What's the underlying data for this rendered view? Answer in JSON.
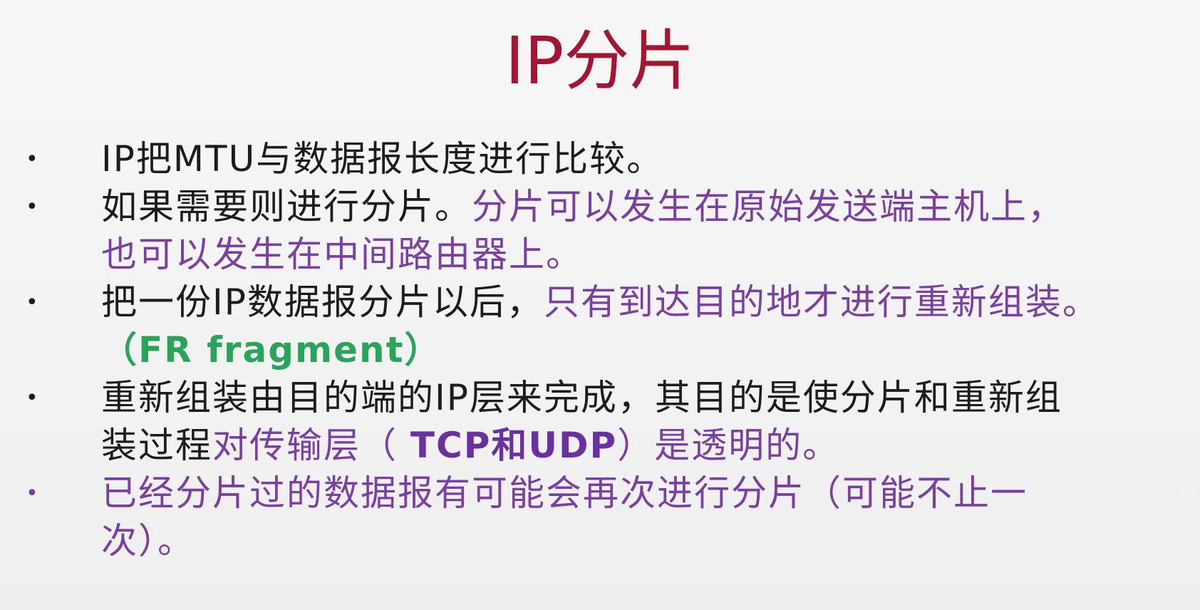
{
  "title": "IP分片",
  "bullets": [
    {
      "dot": "•",
      "lines": [
        [
          {
            "text": "IP把MTU与数据报长度进行比较。",
            "style": "black"
          }
        ]
      ]
    },
    {
      "dot": "•",
      "lines": [
        [
          {
            "text": "如果需要则进行分片。",
            "style": "black"
          },
          {
            "text": "分片可以发生在原始发送端主机上，",
            "style": "purple"
          }
        ],
        [
          {
            "text": "也可以发生在中间路由器上。",
            "style": "purple"
          }
        ]
      ]
    },
    {
      "dot": "•",
      "lines": [
        [
          {
            "text": "把一份IP数据报分片以后，",
            "style": "black"
          },
          {
            "text": "只有到达目的地才进行重新组装。",
            "style": "purple"
          }
        ],
        [
          {
            "text": "（FR fragment）",
            "style": "green"
          }
        ]
      ]
    },
    {
      "dot": "•",
      "lines": [
        [
          {
            "text": "重新组装由目的端的IP层来完成，其目的是使分片和重新组",
            "style": "black"
          }
        ],
        [
          {
            "text": "装过程",
            "style": "black"
          },
          {
            "text": "对传输层（ ",
            "style": "purple"
          },
          {
            "text": "TCP和UDP",
            "style": "purple-bold"
          },
          {
            "text": "）是透明的。",
            "style": "purple"
          }
        ]
      ]
    },
    {
      "dot": "•",
      "dot_style": "purple",
      "lines": [
        [
          {
            "text": "已经分片过的数据报有可能会再次进行分片（可能不止一",
            "style": "purple"
          }
        ],
        [
          {
            "text": "次）。",
            "style": "purple"
          }
        ]
      ]
    }
  ]
}
